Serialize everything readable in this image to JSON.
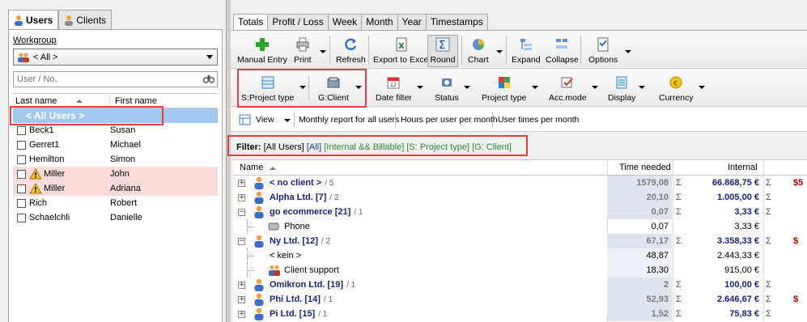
{
  "left": {
    "tabs": [
      {
        "label": "Users",
        "active": true
      },
      {
        "label": "Clients",
        "active": false
      }
    ],
    "workgroup_label": "Workgroup",
    "workgroup_value": "< All >",
    "user_filter_placeholder": "User / No.",
    "columns": [
      "Last name",
      "First name"
    ],
    "all_users_label": "< All Users >",
    "users": [
      {
        "last": "Beck1",
        "first": "Susan",
        "warning": false
      },
      {
        "last": "Gerret1",
        "first": "Michael",
        "warning": false
      },
      {
        "last": "Hemilton",
        "first": "Simon",
        "warning": false
      },
      {
        "last": "Miller",
        "first": "John",
        "warning": true
      },
      {
        "last": "Miller",
        "first": "Adriana",
        "warning": true
      },
      {
        "last": "Rich",
        "first": "Robert",
        "warning": false
      },
      {
        "last": "Schaelchli",
        "first": "Danielle",
        "warning": false
      }
    ]
  },
  "tabs": [
    "Totals",
    "Profit / Loss",
    "Week",
    "Month",
    "Year",
    "Timestamps"
  ],
  "toolbar1": {
    "manual_entry": "Manual Entry",
    "print": "Print",
    "refresh": "Refresh",
    "export_excel": "Export to Excel",
    "round": "Round",
    "chart": "Chart",
    "expand": "Expand",
    "collapse": "Collapse",
    "options": "Options"
  },
  "toolbar2": {
    "project_type_group": "S:Project type",
    "client_group": "G:Client",
    "date_filter": "Date filter",
    "status": "Status",
    "project_type": "Project type",
    "acc_mode": "Acc.mode",
    "display": "Display",
    "currency": "Currency"
  },
  "toolbar3": {
    "view": "View",
    "monthly_report": "Monthly report for all users",
    "hours_per_user": "Hours per user per month",
    "user_times": "User times per month"
  },
  "filter": {
    "label": "Filter:",
    "all_users": "[All Users]",
    "all": "[All]",
    "internal_billable": "[Internal && Billable]",
    "project_type": "[S: Project type]",
    "client": "[G: Client]"
  },
  "grid": {
    "headers": {
      "name": "Name",
      "time_needed": "Time needed",
      "internal": "Internal"
    },
    "rows": [
      {
        "level": 0,
        "expander": "+",
        "name": "< no client >",
        "count": "/ 5",
        "time": "1579,08",
        "internal": "66.868,75 €",
        "extra": "$5"
      },
      {
        "level": 0,
        "expander": "+",
        "name": "Alpha Ltd. [7]",
        "count": "/ 2",
        "time": "20,10",
        "internal": "1.005,00 €",
        "extra": ""
      },
      {
        "level": 0,
        "expander": "−",
        "name": "go ecommerce [21]",
        "count": "/ 1",
        "time": "0,07",
        "internal": "3,33 €",
        "extra": ""
      },
      {
        "level": 1,
        "expander": "",
        "name": "Phone",
        "count": "",
        "time": "0,07",
        "internal": "3,33 €",
        "extra": ""
      },
      {
        "level": 0,
        "expander": "−",
        "name": "Ny Ltd. [12]",
        "count": "/ 2",
        "time": "67,17",
        "internal": "3.358,33 €",
        "extra": "$"
      },
      {
        "level": 1,
        "expander": "",
        "name": "< kein >",
        "count": "",
        "time": "48,87",
        "internal": "2.443,33 €",
        "extra": ""
      },
      {
        "level": 1,
        "expander": "",
        "name": "Client support",
        "count": "",
        "time": "18,30",
        "internal": "915,00 €",
        "extra": ""
      },
      {
        "level": 0,
        "expander": "+",
        "name": "Omikron Ltd. [19]",
        "count": "/ 1",
        "time": "2",
        "internal": "100,00 €",
        "extra": ""
      },
      {
        "level": 0,
        "expander": "+",
        "name": "Phi Ltd. [14]",
        "count": "/ 1",
        "time": "52,93",
        "internal": "2.646,67 €",
        "extra": "$"
      },
      {
        "level": 0,
        "expander": "+",
        "name": "Pi Ltd. [15]",
        "count": "/ 1",
        "time": "1,52",
        "internal": "75,83 €",
        "extra": ""
      }
    ]
  }
}
